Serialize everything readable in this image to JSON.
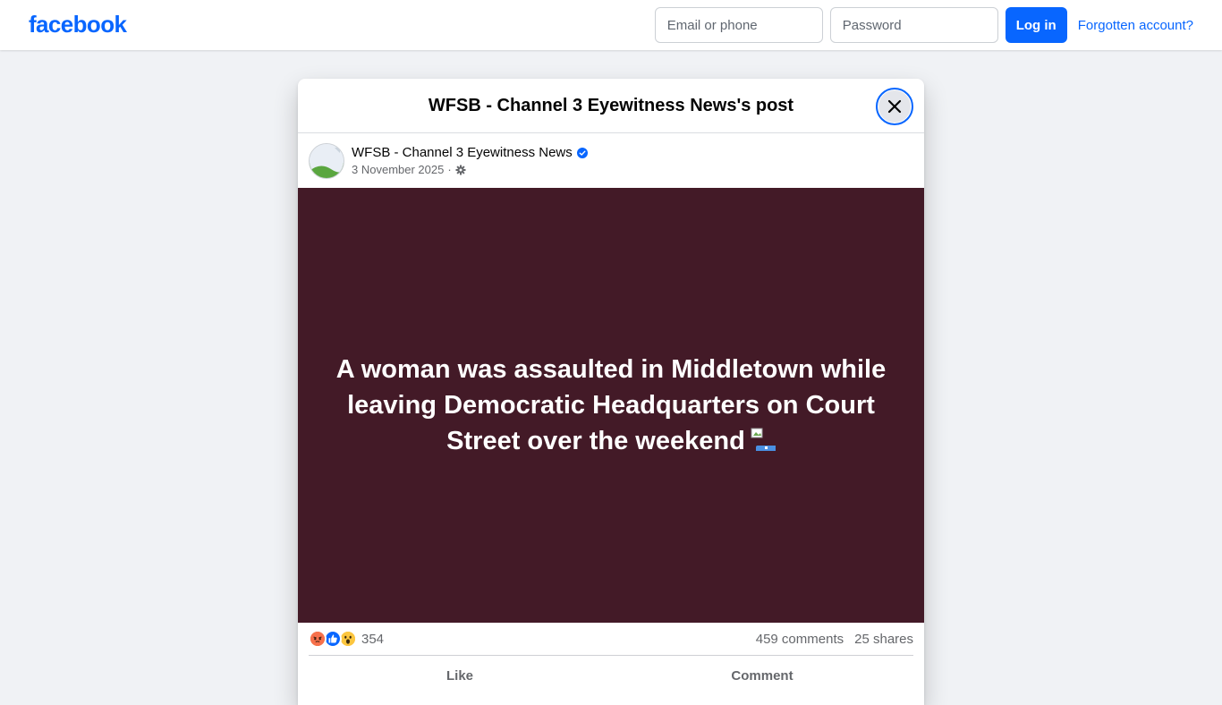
{
  "header": {
    "logo": "facebook",
    "email_placeholder": "Email or phone",
    "password_placeholder": "Password",
    "login_label": "Log in",
    "forgot_label": "Forgotten account?"
  },
  "modal": {
    "title": "WFSB - Channel 3 Eyewitness News's post",
    "post": {
      "page_name": "WFSB - Channel 3 Eyewitness News",
      "verified": true,
      "date": "3 November 2025",
      "separator": "·",
      "text": "A woman was assaulted in Middletown while leaving Democratic Headquarters on Court Street over the weekend",
      "background_color": "#431a27"
    },
    "stats": {
      "reactions": [
        "angry",
        "like",
        "wow"
      ],
      "reaction_count": "354",
      "comments": "459 comments",
      "shares": "25 shares"
    },
    "actions": {
      "like": "Like",
      "comment": "Comment"
    }
  },
  "colors": {
    "brand": "#0866ff",
    "page_background": "#f0f2f5"
  }
}
